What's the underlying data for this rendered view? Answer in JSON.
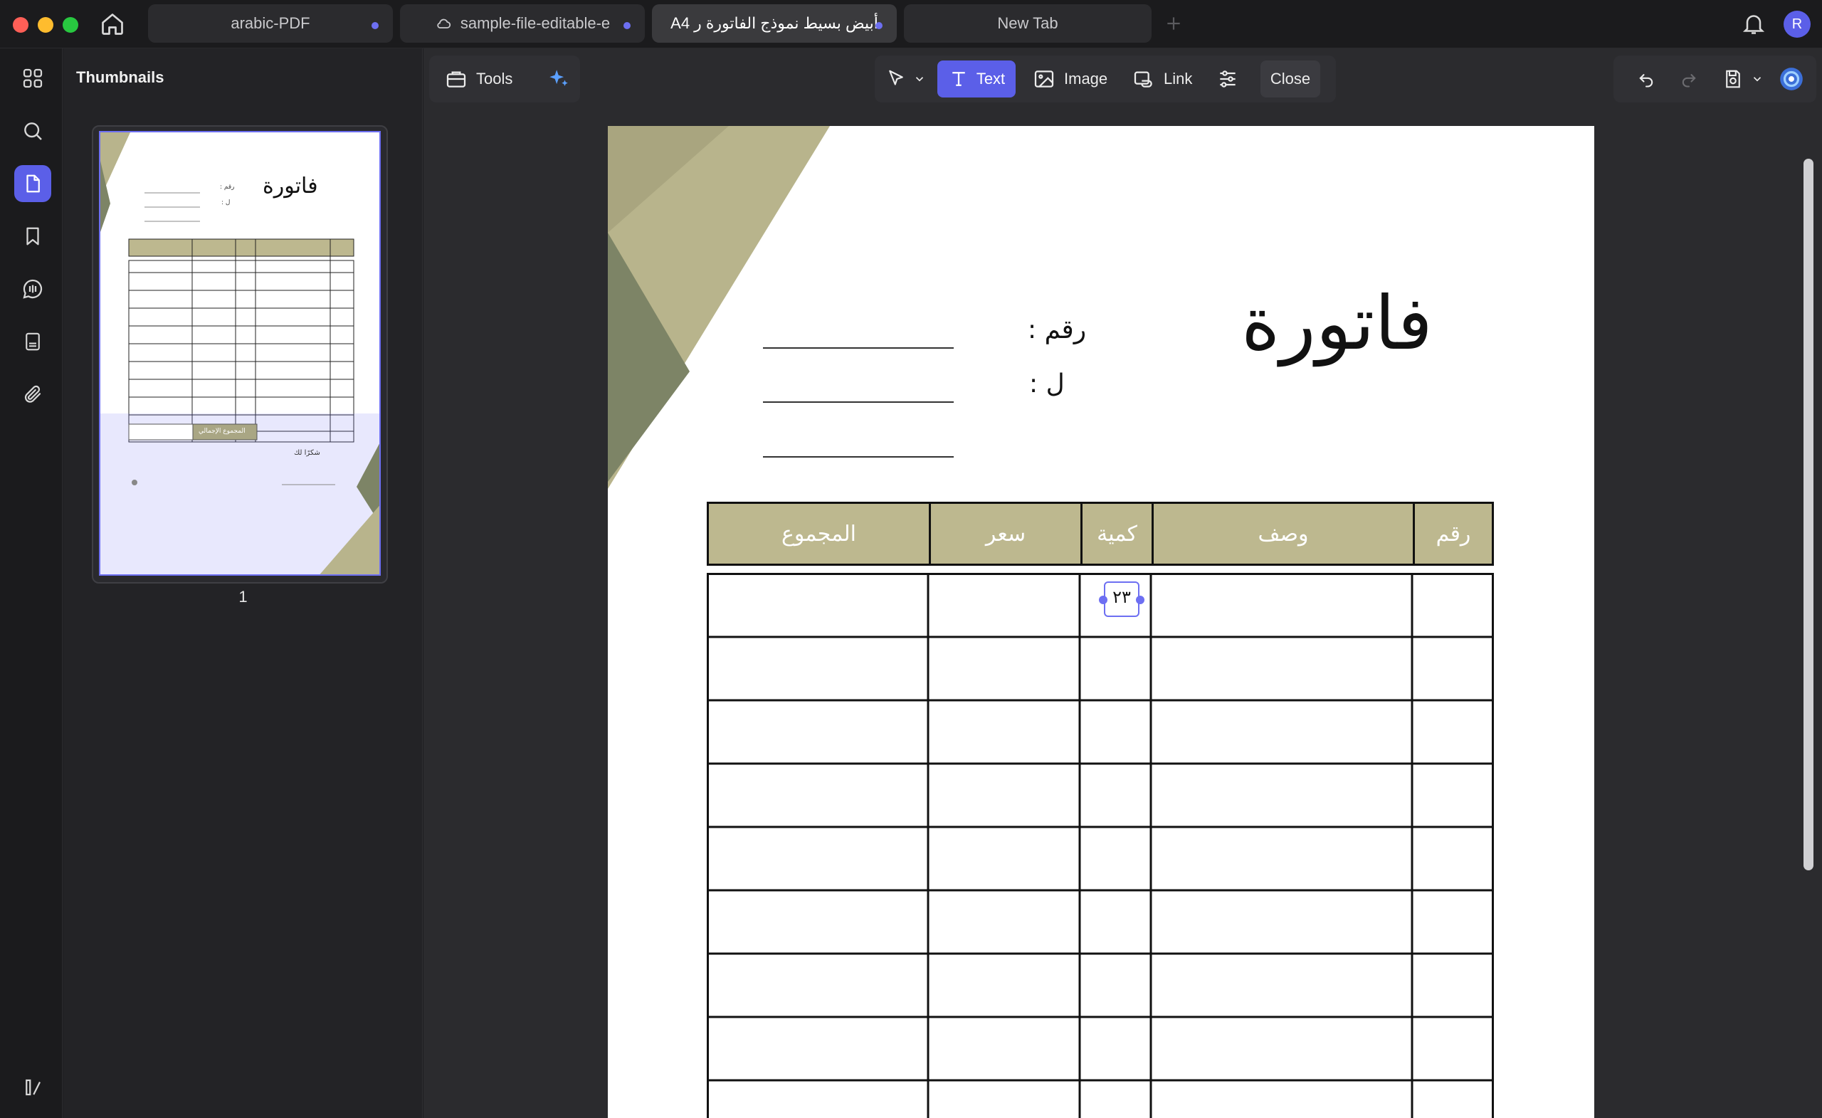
{
  "tabs": [
    {
      "label": "arabic-PDF"
    },
    {
      "label": "sample-file-editable-e"
    },
    {
      "label": "A4 أبيض بسيط نموذج الفاتورة ر"
    },
    {
      "label": "New Tab"
    }
  ],
  "user": {
    "avatar_initial": "R"
  },
  "sidebar": {
    "panel_title": "Thumbnails",
    "page_number": "1"
  },
  "toolbar": {
    "tools_label": "Tools",
    "text_label": "Text",
    "image_label": "Image",
    "link_label": "Link",
    "close_label": "Close"
  },
  "document": {
    "title": "فاتورة",
    "number_label": "رقم :",
    "to_label": "ل :",
    "table_headers": [
      "رقم",
      "وصف",
      "كمية",
      "سعر",
      "المجموع"
    ],
    "editing_value": "٢٣",
    "thumbnail_total_label": "المجموع الإجمالي",
    "thumbnail_thanks": "شكرًا لك"
  },
  "colors": {
    "accent": "#5b5fe8",
    "olive": "#b8b48c",
    "olive_dark": "#7d8466",
    "header_fill": "#bdb88f",
    "close_red": "#fe5f57",
    "minimize_yellow": "#febc2e",
    "zoom_green": "#28c840"
  }
}
